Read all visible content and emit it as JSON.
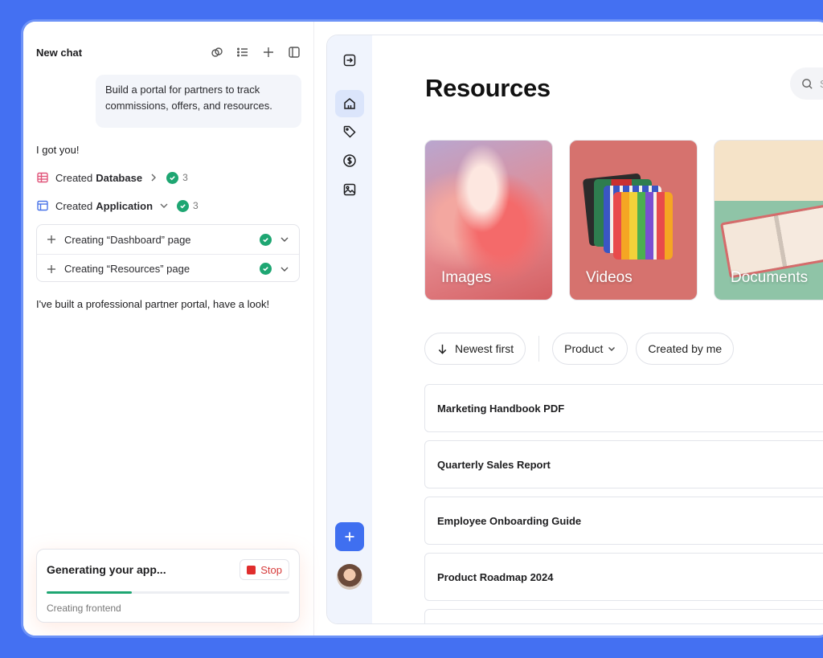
{
  "chat": {
    "title": "New chat",
    "user_message": "Build a portal for partners to track commissions, offers, and resources.",
    "reply_intro": "I got you!",
    "steps": [
      {
        "prefix": "Created",
        "name": "Database",
        "count": "3"
      },
      {
        "prefix": "Created",
        "name": "Application",
        "count": "3"
      }
    ],
    "substeps": [
      {
        "label": "Creating “Dashboard” page"
      },
      {
        "label": "Creating “Resources” page"
      }
    ],
    "reply_done": "I've built a professional partner portal, have a look!",
    "generating": {
      "title": "Generating your app...",
      "stop_label": "Stop",
      "status": "Creating frontend",
      "progress": 0.35
    }
  },
  "app": {
    "page_title": "Resources",
    "search_placeholder": "S",
    "tiles": [
      {
        "label": "Images"
      },
      {
        "label": "Videos"
      },
      {
        "label": "Documents"
      }
    ],
    "filters": {
      "sort": "Newest first",
      "product": "Product",
      "created_by": "Created by me"
    },
    "rows": [
      "Marketing Handbook PDF",
      "Quarterly Sales Report",
      "Employee Onboarding Guide",
      "Product Roadmap 2024"
    ]
  },
  "colors": {
    "background": "#4470f2",
    "accent": "#3f6ff0",
    "success": "#1ea672",
    "danger": "#e02d2d"
  }
}
